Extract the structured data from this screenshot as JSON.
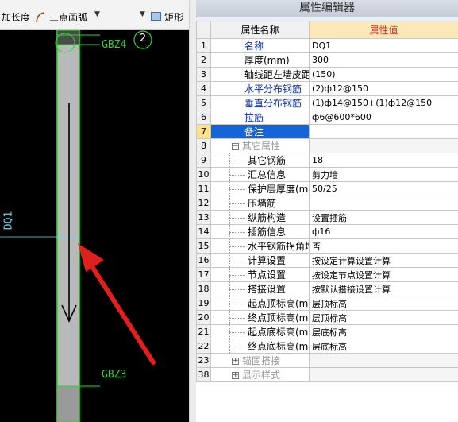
{
  "toolbar": {
    "length_label": "加长度",
    "arc_label": "三点画弧",
    "rect_label": "矩形"
  },
  "canvas": {
    "wall_label": "DQ1",
    "column_top_label": "GBZ4",
    "column_bottom_label": "GBZ3",
    "axis_number": "2"
  },
  "editor": {
    "title": "属性编辑器",
    "col_name_header": "属性名称",
    "col_value_header": "属性值",
    "rows": [
      {
        "num": "1",
        "name": "名称",
        "value": "DQ1"
      },
      {
        "num": "2",
        "name": "厚度(mm)",
        "value": "300"
      },
      {
        "num": "3",
        "name": "轴线距左墙皮距离",
        "value": "(150)"
      },
      {
        "num": "4",
        "name": "水平分布钢筋",
        "value": "(2)ф12@150"
      },
      {
        "num": "5",
        "name": "垂直分布钢筋",
        "value": "(1)ф14@150+(1)ф12@150"
      },
      {
        "num": "6",
        "name": "拉筋",
        "value": "ф6@600*600"
      },
      {
        "num": "7",
        "name": "备注",
        "value": ""
      },
      {
        "num": "8",
        "name": "其它属性",
        "value": ""
      },
      {
        "num": "9",
        "name": "其它钢筋",
        "value": "18"
      },
      {
        "num": "10",
        "name": "汇总信息",
        "value": "剪力墙"
      },
      {
        "num": "11",
        "name": "保护层厚度(mm)",
        "value": "50/25"
      },
      {
        "num": "12",
        "name": "压墙筋",
        "value": ""
      },
      {
        "num": "13",
        "name": "纵筋构造",
        "value": "设置插筋"
      },
      {
        "num": "14",
        "name": "插筋信息",
        "value": "ф16"
      },
      {
        "num": "15",
        "name": "水平钢筋拐角增",
        "value": "否"
      },
      {
        "num": "16",
        "name": "计算设置",
        "value": "按设定计算设置计算"
      },
      {
        "num": "17",
        "name": "节点设置",
        "value": "按设定节点设置计算"
      },
      {
        "num": "18",
        "name": "搭接设置",
        "value": "按默认搭接设置计算"
      },
      {
        "num": "19",
        "name": "起点顶标高(m)",
        "value": "层顶标高"
      },
      {
        "num": "20",
        "name": "终点顶标高(m)",
        "value": "层顶标高"
      },
      {
        "num": "21",
        "name": "起点底标高(m)",
        "value": "层底标高"
      },
      {
        "num": "22",
        "name": "终点底标高(m)",
        "value": "层底标高"
      },
      {
        "num": "23",
        "name": "锚固搭接",
        "value": ""
      },
      {
        "num": "38",
        "name": "显示样式",
        "value": ""
      }
    ]
  },
  "colors": {
    "name_blue": "#0b2fa8",
    "selection": "#1565d8",
    "value_header_bg": "#fce7b6",
    "value_header_text": "#c0392b",
    "annotation_arrow": "#e0201d",
    "canvas_bg": "#000000",
    "wall_fill": "#b9b9b9",
    "column_green": "#2fd52f"
  }
}
